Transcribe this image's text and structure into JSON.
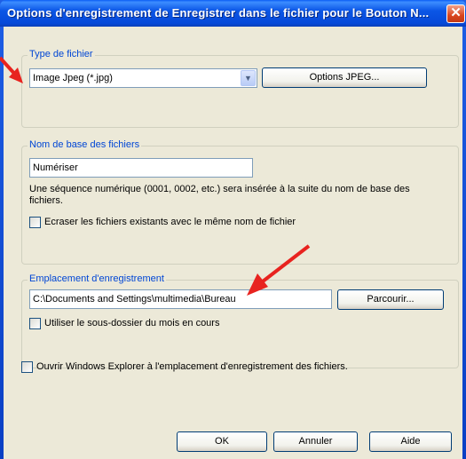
{
  "window": {
    "title": "Options d'enregistrement de Enregistrer dans le fichier pour le Bouton N...",
    "close_glyph": "✕"
  },
  "file_type": {
    "legend": "Type de fichier",
    "selected": "Image Jpeg (*.jpg)",
    "options_button": "Options JPEG..."
  },
  "base_name": {
    "legend": "Nom de base des fichiers",
    "value": "Numériser",
    "description": "Une séquence numérique (0001, 0002, etc.) sera insérée à la suite du nom de base des fichiers.",
    "overwrite_label": "Ecraser les fichiers existants avec le même nom de fichier",
    "overwrite_checked": false
  },
  "location": {
    "legend": "Emplacement d'enregistrement",
    "path": "C:\\Documents and Settings\\multimedia\\Bureau",
    "browse_button": "Parcourir...",
    "monthly_subfolder_label": "Utiliser le sous-dossier du mois en cours",
    "monthly_subfolder_checked": false
  },
  "open_explorer": {
    "label": "Ouvrir Windows Explorer à l'emplacement d'enregistrement des fichiers.",
    "checked": false
  },
  "buttons": {
    "ok": "OK",
    "cancel": "Annuler",
    "help": "Aide"
  },
  "annotation_color": "#e8231f"
}
